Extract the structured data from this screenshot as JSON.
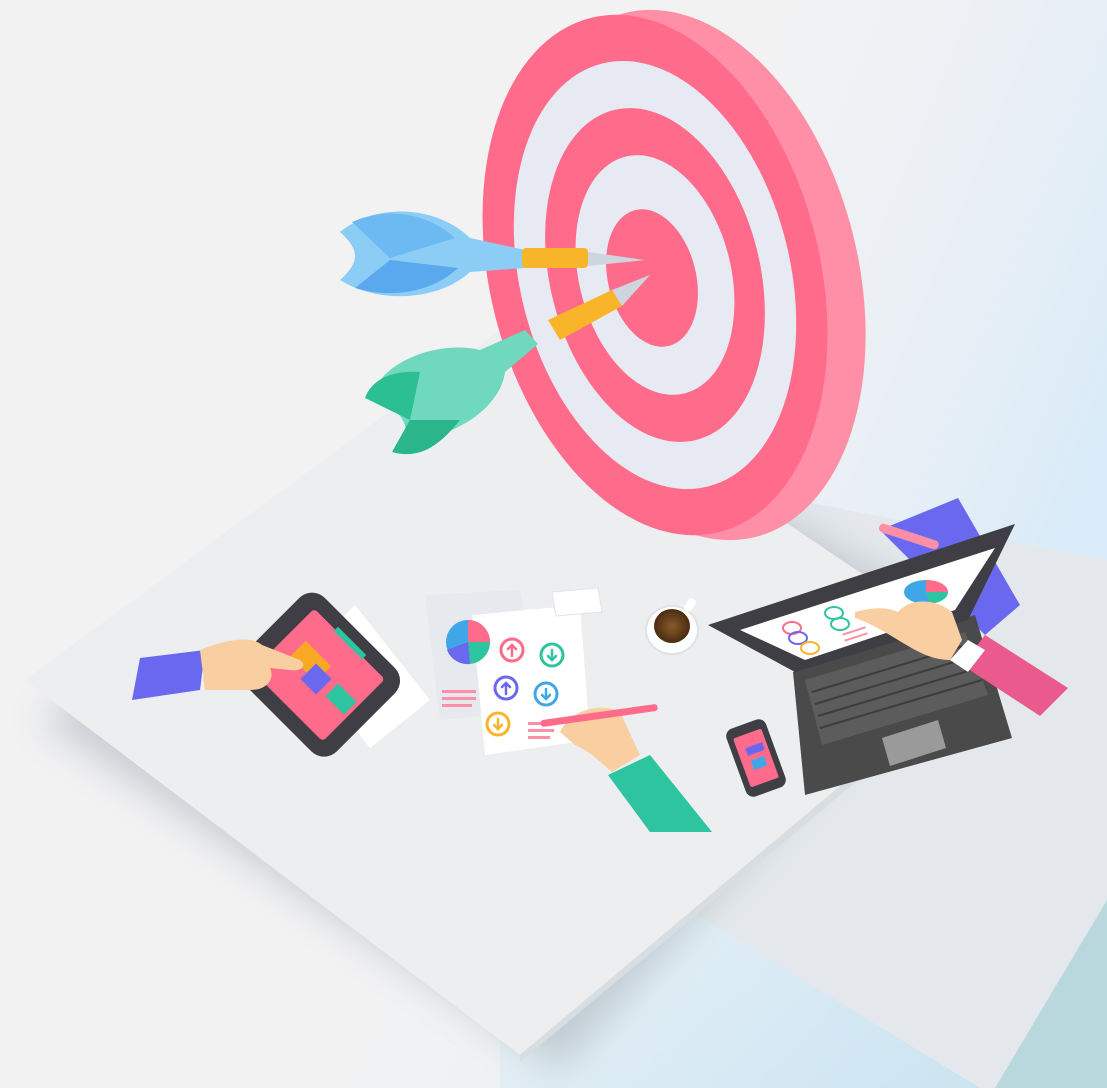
{
  "scene": {
    "subject": "teamwork-target-illustration",
    "elements": {
      "target": "dartboard-target",
      "darts": [
        "blue-dart",
        "green-dart"
      ],
      "devices": [
        "tablet",
        "laptop",
        "smartphone"
      ],
      "props": [
        "coffee-cup",
        "pen",
        "report-papers",
        "business-card",
        "notebook"
      ],
      "hands": [
        "purple-sleeve-hand",
        "green-sleeve-hand",
        "pink-sleeve-hand"
      ]
    },
    "colors": {
      "background": "#f2f2f3",
      "background_tint": "#dcecf7",
      "table_top": "#eceef0",
      "target_red": "#ff6b8a",
      "target_light": "#e8eaf3",
      "target_side": "#ff8fa6",
      "dart_blue": "#8ccdf6",
      "dart_green": "#6fd8be",
      "dart_shaft_orange": "#f9b52a",
      "laptop_body": "#4a4a4a",
      "sleeve_purple": "#6b68f0",
      "sleeve_green": "#2ec4a0",
      "sleeve_pink": "#ea5a8c",
      "skin": "#f9cfa2"
    }
  }
}
